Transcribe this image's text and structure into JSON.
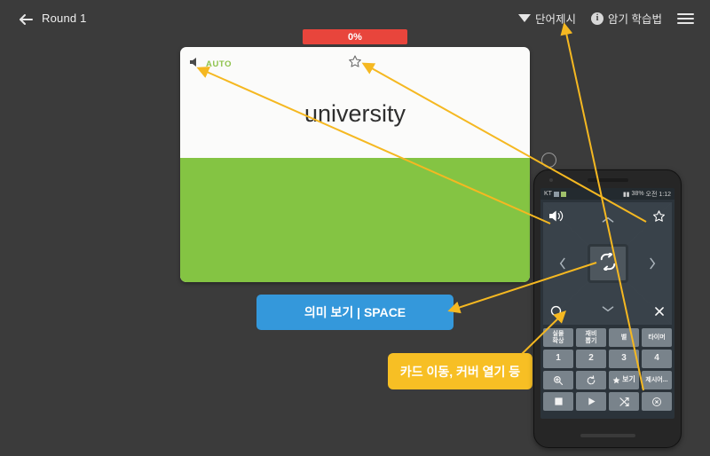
{
  "header": {
    "back_icon": "arrow-left-icon",
    "title": "Round 1",
    "right_items": [
      {
        "icon": "triangle-down-icon",
        "label": "단어제시"
      },
      {
        "icon": "info-circle-icon",
        "label": "암기 학습법"
      },
      {
        "icon": "hamburger-menu-icon",
        "label": ""
      }
    ],
    "info_glyph": "i"
  },
  "progress": {
    "percent_label": "0%",
    "value": 0,
    "color": "#e8453c"
  },
  "card": {
    "speaker_icon": "speaker-icon",
    "auto_label": "AUTO",
    "auto_color": "#8dc24a",
    "star_icon": "star-outline-icon",
    "word": "university",
    "cover_color": "#84c443",
    "background": "#fbfbfa"
  },
  "space_button": {
    "label": "의미 보기 | SPACE",
    "color": "#3498db"
  },
  "callout": {
    "label": "카드 이동, 커버 열기 등",
    "color": "#f7bf24"
  },
  "phone": {
    "statusbar": {
      "carrier": "KT",
      "battery": "38%",
      "time": "오전 1:12"
    },
    "dpad": {
      "top_left_icon": "speaker-icon",
      "top_right_icon": "star-outline-icon",
      "bottom_left_icon": "circle-outline-icon",
      "bottom_right_icon": "close-x-icon",
      "up_icon": "chevron-up-icon",
      "down_icon": "chevron-down-icon",
      "left_icon": "chevron-left-icon",
      "right_icon": "chevron-right-icon",
      "center_icon": "repeat-loop-icon"
    },
    "key_rows": [
      [
        {
          "label": "실물\n확상",
          "icon": ""
        },
        {
          "label": "재비\n뽑기",
          "icon": ""
        },
        {
          "label": "벨",
          "icon": ""
        },
        {
          "label": "타이머",
          "icon": ""
        }
      ],
      [
        {
          "label": "1",
          "icon": ""
        },
        {
          "label": "2",
          "icon": ""
        },
        {
          "label": "3",
          "icon": ""
        },
        {
          "label": "4",
          "icon": ""
        }
      ],
      [
        {
          "label": "",
          "icon": "zoom-search-icon"
        },
        {
          "label": "",
          "icon": "refresh-icon"
        },
        {
          "label": "보기",
          "icon": "star-filled-icon"
        },
        {
          "label": "제시어...",
          "icon": ""
        }
      ],
      [
        {
          "label": "",
          "icon": "stop-square-icon"
        },
        {
          "label": "",
          "icon": "play-triangle-icon"
        },
        {
          "label": "",
          "icon": "shuffle-icon"
        },
        {
          "label": "",
          "icon": "clear-circle-icon"
        }
      ]
    ]
  },
  "annotations": {
    "arrow_color": "#f5b821",
    "marker_icon": "circle-marker"
  }
}
